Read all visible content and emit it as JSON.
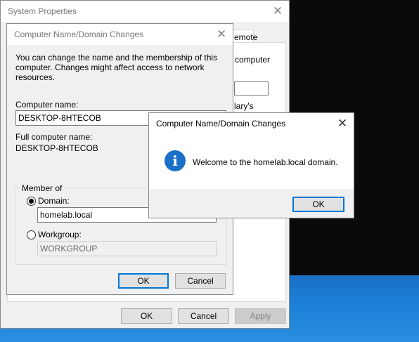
{
  "system_properties": {
    "title": "System Properties",
    "close_glyph": "✕",
    "tab_remote": "emote",
    "partial_text_1": "computer",
    "partial_text_2": "lary's",
    "ok_label": "OK",
    "cancel_label": "Cancel",
    "apply_label": "Apply"
  },
  "name_change_dialog": {
    "title": "Computer Name/Domain Changes",
    "close_glyph": "✕",
    "description": "You can change the name and the membership of this computer. Changes might affect access to network resources.",
    "computer_name_label": "Computer name:",
    "computer_name_value": "DESKTOP-8HTECOB",
    "full_name_label": "Full computer name:",
    "full_name_value": "DESKTOP-8HTECOB",
    "member_of_label": "Member of",
    "domain_label": "Domain:",
    "domain_value": "homelab.local",
    "domain_selected": true,
    "workgroup_label": "Workgroup:",
    "workgroup_value": "WORKGROUP",
    "ok_label": "OK",
    "cancel_label": "Cancel"
  },
  "welcome_message": {
    "title": "Computer Name/Domain Changes",
    "close_glyph": "✕",
    "icon": "info-icon",
    "icon_glyph": "i",
    "message": "Welcome to the homelab.local domain.",
    "ok_label": "OK"
  },
  "colors": {
    "accent": "#0078d7",
    "info_icon": "#1a6fc6",
    "desktop_blue": "#1b7fd6"
  }
}
